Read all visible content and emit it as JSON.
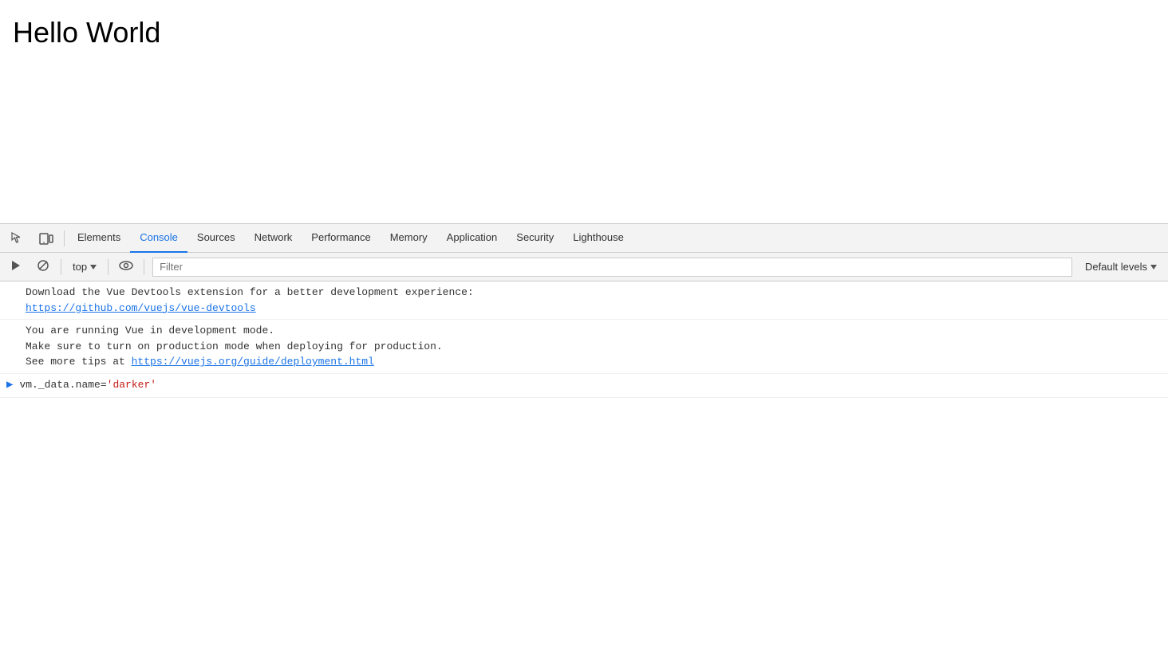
{
  "page": {
    "title": "Hello World"
  },
  "devtools": {
    "tabs": [
      {
        "id": "elements",
        "label": "Elements",
        "active": false
      },
      {
        "id": "console",
        "label": "Console",
        "active": true
      },
      {
        "id": "sources",
        "label": "Sources",
        "active": false
      },
      {
        "id": "network",
        "label": "Network",
        "active": false
      },
      {
        "id": "performance",
        "label": "Performance",
        "active": false
      },
      {
        "id": "memory",
        "label": "Memory",
        "active": false
      },
      {
        "id": "application",
        "label": "Application",
        "active": false
      },
      {
        "id": "security",
        "label": "Security",
        "active": false
      },
      {
        "id": "lighthouse",
        "label": "Lighthouse",
        "active": false
      }
    ],
    "console": {
      "context": "top",
      "filter_placeholder": "Filter",
      "levels_label": "Default levels",
      "messages": [
        {
          "id": "vue-devtools-msg",
          "text": "Download the Vue Devtools extension for a better development experience:",
          "link_text": "https://github.com/vuejs/vue-devtools",
          "link_href": "https://github.com/vuejs/vue-devtools"
        },
        {
          "id": "vue-dev-mode-msg",
          "lines": [
            "You are running Vue in development mode.",
            "Make sure to turn on production mode when deploying for production.",
            "See more tips at "
          ],
          "link_text": "https://vuejs.org/guide/deployment.html",
          "link_href": "https://vuejs.org/guide/deployment.html"
        }
      ],
      "prompt": {
        "prefix": "vm._data.name=",
        "string_value": "'darker'"
      }
    }
  }
}
